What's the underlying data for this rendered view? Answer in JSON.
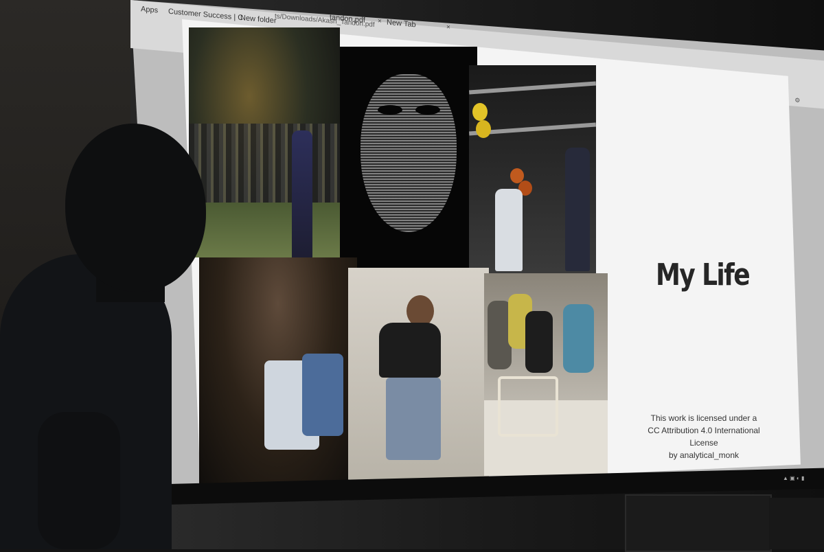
{
  "browser": {
    "bookmark_apps": "Apps",
    "bookmark_1": "Customer Success | C",
    "bookmark_2": "New folder",
    "url_fragment": "ts/Downloads/Akash_Tandon.pdf",
    "tab_1": "tandon.pdf",
    "tab_2": "New Tab"
  },
  "slide": {
    "title": "My Life",
    "license_lines": [
      "This work is licensed under a",
      "CC Attribution 4.0 International License",
      "by analytical_monk"
    ]
  },
  "photos": [
    {
      "name": "cricket-match-photo"
    },
    {
      "name": "guy-fawkes-mask-photo"
    },
    {
      "name": "stage-balloons-photo"
    },
    {
      "name": "party-photo"
    },
    {
      "name": "student-sitting-photo"
    },
    {
      "name": "group-photo"
    }
  ]
}
